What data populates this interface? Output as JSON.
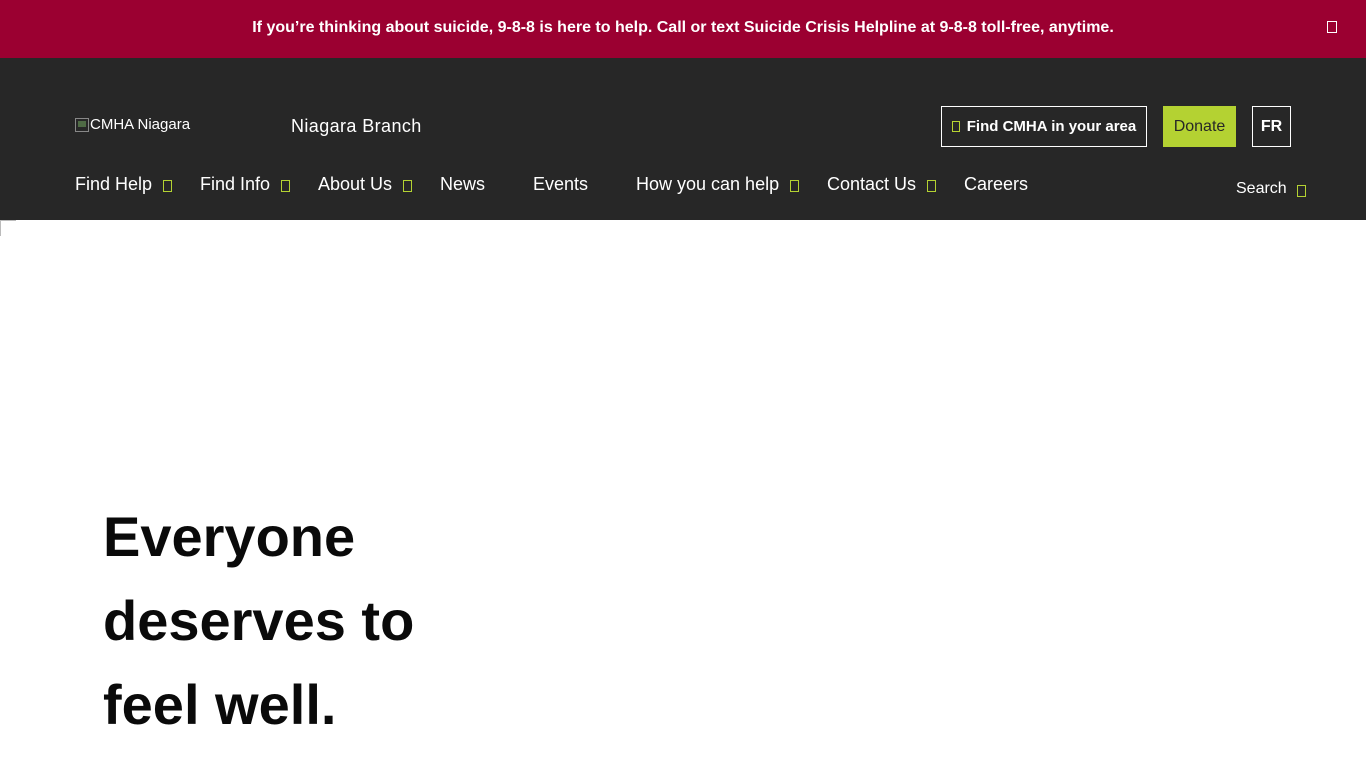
{
  "alert": {
    "message": "If you’re thinking about suicide, 9-8-8 is here to help. Call or text Suicide Crisis Helpline at 9-8-8 toll-free, anytime.",
    "background": "#9b0031"
  },
  "header": {
    "logo_alt": "CMHA Niagara",
    "branch": "Niagara Branch",
    "find_button": "Find CMHA in your area",
    "donate_button": "Donate",
    "language_button": "FR",
    "accent": "#b4d232",
    "background": "#272727"
  },
  "nav": {
    "items": [
      {
        "label": "Find Help"
      },
      {
        "label": "Find Info"
      },
      {
        "label": "About Us"
      },
      {
        "label": "News"
      },
      {
        "label": "Events"
      },
      {
        "label": "How you can help"
      },
      {
        "label": "Contact Us"
      },
      {
        "label": "Careers"
      }
    ],
    "search_label": "Search"
  },
  "hero": {
    "title_lines": [
      "Everyone",
      "deserves to",
      "feel well."
    ]
  }
}
